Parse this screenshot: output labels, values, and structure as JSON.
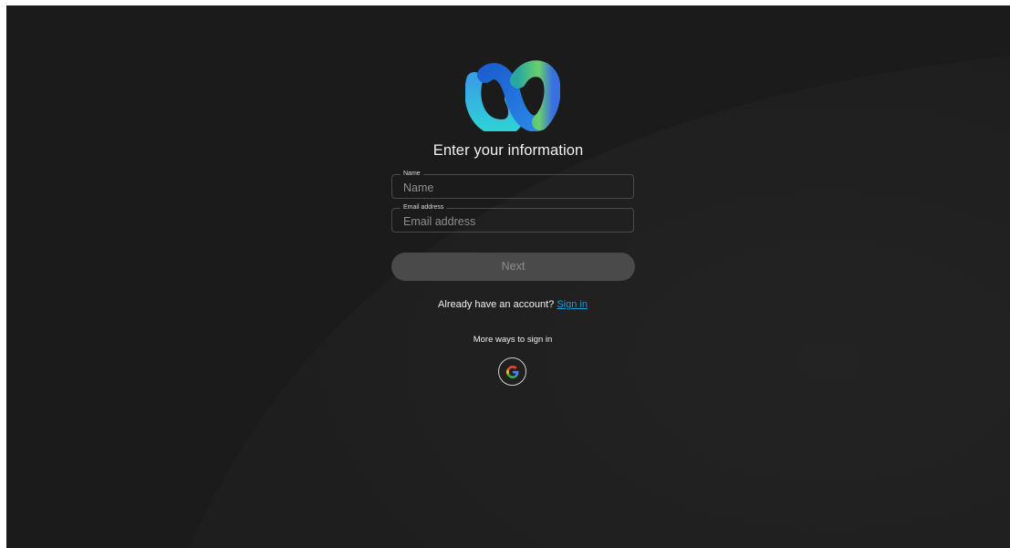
{
  "page": {
    "title": "Enter your information"
  },
  "form": {
    "name_field": {
      "label": "Name",
      "placeholder": "Name",
      "value": ""
    },
    "email_field": {
      "label": "Email address",
      "placeholder": "Email address",
      "value": ""
    },
    "next_label": "Next",
    "next_state": "disabled"
  },
  "account": {
    "prompt": "Already have an account?",
    "sign_in_link": "Sign in"
  },
  "alt_signin": {
    "heading": "More ways to sign in",
    "providers": [
      {
        "icon": "google-g-icon"
      }
    ]
  },
  "icons": {
    "logo": "webex-logo",
    "google": "google-g-icon"
  },
  "colors": {
    "background": "#1b1b1b",
    "link": "#1a9bd7",
    "button_disabled_bg": "#4a4a4a",
    "button_disabled_text": "#8c8c8c",
    "logo_blue": "#1f7ae0",
    "logo_green": "#5ec37a",
    "logo_cyan": "#3cc6d8"
  }
}
